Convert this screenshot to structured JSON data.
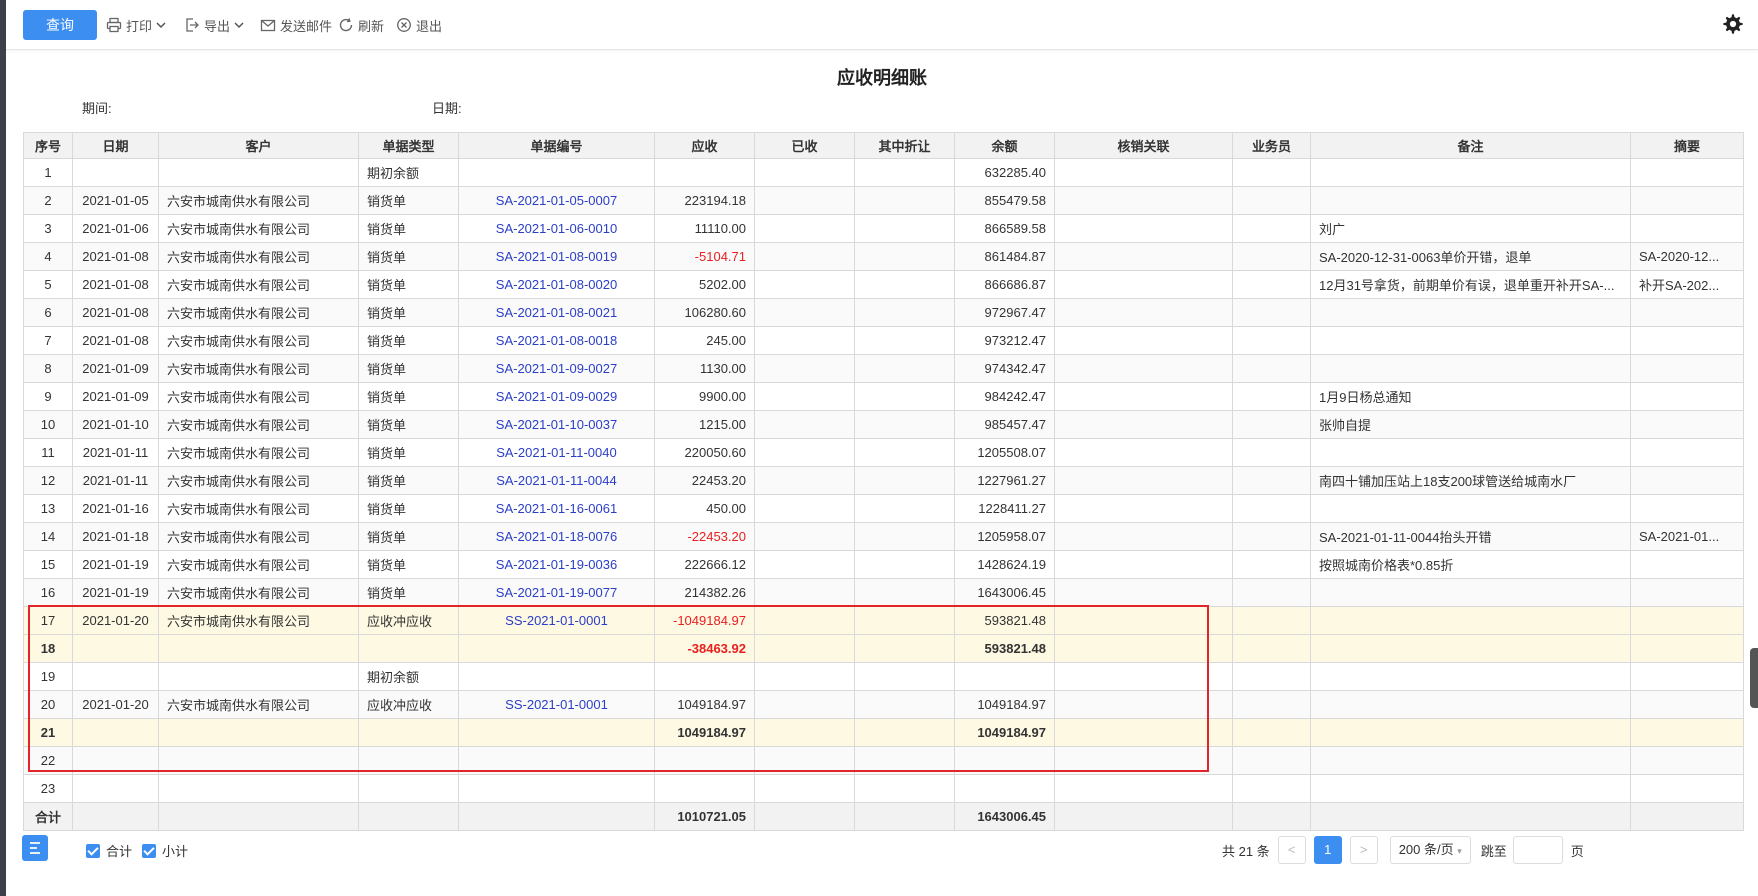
{
  "toolbar": {
    "query_label": "查询",
    "print_label": "打印",
    "export_label": "导出",
    "email_label": "发送邮件",
    "refresh_label": "刷新",
    "exit_label": "退出"
  },
  "report": {
    "title": "应收明细账",
    "period_label": "期间:",
    "date_label": "日期:"
  },
  "columns": [
    "序号",
    "日期",
    "客户",
    "单据类型",
    "单据编号",
    "应收",
    "已收",
    "其中折让",
    "余额",
    "核销关联",
    "业务员",
    "备注",
    "摘要"
  ],
  "rows": [
    {
      "seq": "1",
      "date": "",
      "customer": "",
      "type": "期初余额",
      "no": "",
      "recv": "",
      "recv_neg": false,
      "got": "",
      "disc": "",
      "bal": "632285.40",
      "rel": "",
      "sales": "",
      "note": "",
      "summary": "",
      "style": ""
    },
    {
      "seq": "2",
      "date": "2021-01-05",
      "customer": "六安市城南供水有限公司",
      "type": "销货单",
      "no": "SA-2021-01-05-0007",
      "recv": "223194.18",
      "recv_neg": false,
      "got": "",
      "disc": "",
      "bal": "855479.58",
      "rel": "",
      "sales": "",
      "note": "",
      "summary": "",
      "style": "alt"
    },
    {
      "seq": "3",
      "date": "2021-01-06",
      "customer": "六安市城南供水有限公司",
      "type": "销货单",
      "no": "SA-2021-01-06-0010",
      "recv": "11110.00",
      "recv_neg": false,
      "got": "",
      "disc": "",
      "bal": "866589.58",
      "rel": "",
      "sales": "",
      "note": "刘广",
      "summary": "",
      "style": ""
    },
    {
      "seq": "4",
      "date": "2021-01-08",
      "customer": "六安市城南供水有限公司",
      "type": "销货单",
      "no": "SA-2021-01-08-0019",
      "recv": "-5104.71",
      "recv_neg": true,
      "got": "",
      "disc": "",
      "bal": "861484.87",
      "rel": "",
      "sales": "",
      "note": "SA-2020-12-31-0063单价开错，退单",
      "summary": "SA-2020-12...",
      "style": "alt"
    },
    {
      "seq": "5",
      "date": "2021-01-08",
      "customer": "六安市城南供水有限公司",
      "type": "销货单",
      "no": "SA-2021-01-08-0020",
      "recv": "5202.00",
      "recv_neg": false,
      "got": "",
      "disc": "",
      "bal": "866686.87",
      "rel": "",
      "sales": "",
      "note": "12月31号拿货，前期单价有误，退单重开补开SA-...",
      "summary": "补开SA-202...",
      "style": ""
    },
    {
      "seq": "6",
      "date": "2021-01-08",
      "customer": "六安市城南供水有限公司",
      "type": "销货单",
      "no": "SA-2021-01-08-0021",
      "recv": "106280.60",
      "recv_neg": false,
      "got": "",
      "disc": "",
      "bal": "972967.47",
      "rel": "",
      "sales": "",
      "note": "",
      "summary": "",
      "style": "alt"
    },
    {
      "seq": "7",
      "date": "2021-01-08",
      "customer": "六安市城南供水有限公司",
      "type": "销货单",
      "no": "SA-2021-01-08-0018",
      "recv": "245.00",
      "recv_neg": false,
      "got": "",
      "disc": "",
      "bal": "973212.47",
      "rel": "",
      "sales": "",
      "note": "",
      "summary": "",
      "style": ""
    },
    {
      "seq": "8",
      "date": "2021-01-09",
      "customer": "六安市城南供水有限公司",
      "type": "销货单",
      "no": "SA-2021-01-09-0027",
      "recv": "1130.00",
      "recv_neg": false,
      "got": "",
      "disc": "",
      "bal": "974342.47",
      "rel": "",
      "sales": "",
      "note": "",
      "summary": "",
      "style": "alt"
    },
    {
      "seq": "9",
      "date": "2021-01-09",
      "customer": "六安市城南供水有限公司",
      "type": "销货单",
      "no": "SA-2021-01-09-0029",
      "recv": "9900.00",
      "recv_neg": false,
      "got": "",
      "disc": "",
      "bal": "984242.47",
      "rel": "",
      "sales": "",
      "note": "1月9日杨总通知",
      "summary": "",
      "style": ""
    },
    {
      "seq": "10",
      "date": "2021-01-10",
      "customer": "六安市城南供水有限公司",
      "type": "销货单",
      "no": "SA-2021-01-10-0037",
      "recv": "1215.00",
      "recv_neg": false,
      "got": "",
      "disc": "",
      "bal": "985457.47",
      "rel": "",
      "sales": "",
      "note": "张帅自提",
      "summary": "",
      "style": "alt"
    },
    {
      "seq": "11",
      "date": "2021-01-11",
      "customer": "六安市城南供水有限公司",
      "type": "销货单",
      "no": "SA-2021-01-11-0040",
      "recv": "220050.60",
      "recv_neg": false,
      "got": "",
      "disc": "",
      "bal": "1205508.07",
      "rel": "",
      "sales": "",
      "note": "",
      "summary": "",
      "style": ""
    },
    {
      "seq": "12",
      "date": "2021-01-11",
      "customer": "六安市城南供水有限公司",
      "type": "销货单",
      "no": "SA-2021-01-11-0044",
      "recv": "22453.20",
      "recv_neg": false,
      "got": "",
      "disc": "",
      "bal": "1227961.27",
      "rel": "",
      "sales": "",
      "note": "南四十铺加压站上18支200球管送给城南水厂",
      "summary": "",
      "style": "alt"
    },
    {
      "seq": "13",
      "date": "2021-01-16",
      "customer": "六安市城南供水有限公司",
      "type": "销货单",
      "no": "SA-2021-01-16-0061",
      "recv": "450.00",
      "recv_neg": false,
      "got": "",
      "disc": "",
      "bal": "1228411.27",
      "rel": "",
      "sales": "",
      "note": "",
      "summary": "",
      "style": ""
    },
    {
      "seq": "14",
      "date": "2021-01-18",
      "customer": "六安市城南供水有限公司",
      "type": "销货单",
      "no": "SA-2021-01-18-0076",
      "recv": "-22453.20",
      "recv_neg": true,
      "got": "",
      "disc": "",
      "bal": "1205958.07",
      "rel": "",
      "sales": "",
      "note": "SA-2021-01-11-0044抬头开错",
      "summary": "SA-2021-01...",
      "style": "alt"
    },
    {
      "seq": "15",
      "date": "2021-01-19",
      "customer": "六安市城南供水有限公司",
      "type": "销货单",
      "no": "SA-2021-01-19-0036",
      "recv": "222666.12",
      "recv_neg": false,
      "got": "",
      "disc": "",
      "bal": "1428624.19",
      "rel": "",
      "sales": "",
      "note": "按照城南价格表*0.85折",
      "summary": "",
      "style": ""
    },
    {
      "seq": "16",
      "date": "2021-01-19",
      "customer": "六安市城南供水有限公司",
      "type": "销货单",
      "no": "SA-2021-01-19-0077",
      "recv": "214382.26",
      "recv_neg": false,
      "got": "",
      "disc": "",
      "bal": "1643006.45",
      "rel": "",
      "sales": "",
      "note": "",
      "summary": "",
      "style": "alt"
    },
    {
      "seq": "17",
      "date": "2021-01-20",
      "customer": "六安市城南供水有限公司",
      "type": "应收冲应收",
      "no": "SS-2021-01-0001",
      "recv": "-1049184.97",
      "recv_neg": true,
      "got": "",
      "disc": "",
      "bal": "593821.48",
      "rel": "",
      "sales": "",
      "note": "",
      "summary": "",
      "style": "hl"
    },
    {
      "seq": "18",
      "date": "",
      "customer": "",
      "type": "",
      "no": "",
      "recv": "-38463.92",
      "recv_neg": true,
      "got": "",
      "disc": "",
      "bal": "593821.48",
      "rel": "",
      "sales": "",
      "note": "",
      "summary": "",
      "style": "sub"
    },
    {
      "seq": "19",
      "date": "",
      "customer": "",
      "type": "期初余额",
      "no": "",
      "recv": "",
      "recv_neg": false,
      "got": "",
      "disc": "",
      "bal": "",
      "rel": "",
      "sales": "",
      "note": "",
      "summary": "",
      "style": ""
    },
    {
      "seq": "20",
      "date": "2021-01-20",
      "customer": "六安市城南供水有限公司",
      "type": "应收冲应收",
      "no": "SS-2021-01-0001",
      "recv": "1049184.97",
      "recv_neg": false,
      "got": "",
      "disc": "",
      "bal": "1049184.97",
      "rel": "",
      "sales": "",
      "note": "",
      "summary": "",
      "style": "alt"
    },
    {
      "seq": "21",
      "date": "",
      "customer": "",
      "type": "",
      "no": "",
      "recv": "1049184.97",
      "recv_neg": false,
      "got": "",
      "disc": "",
      "bal": "1049184.97",
      "rel": "",
      "sales": "",
      "note": "",
      "summary": "",
      "style": "sub"
    },
    {
      "seq": "22",
      "date": "",
      "customer": "",
      "type": "",
      "no": "",
      "recv": "",
      "recv_neg": false,
      "got": "",
      "disc": "",
      "bal": "",
      "rel": "",
      "sales": "",
      "note": "",
      "summary": "",
      "style": "alt"
    },
    {
      "seq": "23",
      "date": "",
      "customer": "",
      "type": "",
      "no": "",
      "recv": "",
      "recv_neg": false,
      "got": "",
      "disc": "",
      "bal": "",
      "rel": "",
      "sales": "",
      "note": "",
      "summary": "",
      "style": ""
    }
  ],
  "total": {
    "label": "合计",
    "recv": "1010721.05",
    "bal": "1643006.45"
  },
  "footer": {
    "chk_total_label": "合计",
    "chk_subtotal_label": "小计",
    "count_text": "共 21 条",
    "prev": "<",
    "current_page": "1",
    "next": ">",
    "page_size": "200 条/页",
    "jump_label": "跳至",
    "page_unit": "页"
  },
  "colors": {
    "accent": "#3c8ff0",
    "negative": "#e82020",
    "link": "#2b3ec7",
    "highlight_box": "#e0262b"
  }
}
